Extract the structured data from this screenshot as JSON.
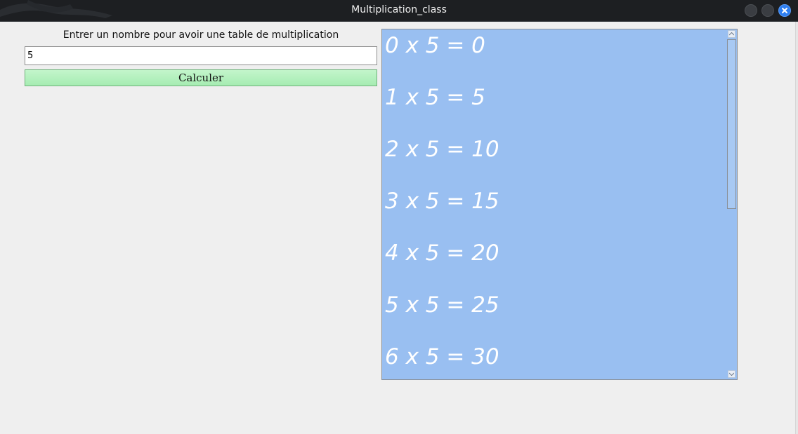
{
  "window": {
    "title": "Multiplication_class"
  },
  "form": {
    "prompt_label": "Entrer un nombre pour avoir une table de multiplication",
    "input_value": "5",
    "button_label": "Calculer"
  },
  "results": {
    "lines": [
      "0 x 5 = 0",
      "1 x 5 = 5",
      "2 x 5 = 10",
      "3 x 5 = 15",
      "4 x 5 = 20",
      "5 x 5 = 25",
      "6 x 5 = 30"
    ]
  },
  "colors": {
    "titlebar": "#1d1f22",
    "close_button": "#2f7ff0",
    "button_green": "#a6ecb2",
    "results_background": "#99bff1",
    "results_text": "#ffffff"
  },
  "icons": {
    "title_logo": "dragon-logo-icon",
    "minimize": "minimize-icon",
    "maximize": "maximize-icon",
    "close": "close-icon",
    "scroll_up": "arrow-up-icon",
    "scroll_down": "arrow-down-icon"
  }
}
